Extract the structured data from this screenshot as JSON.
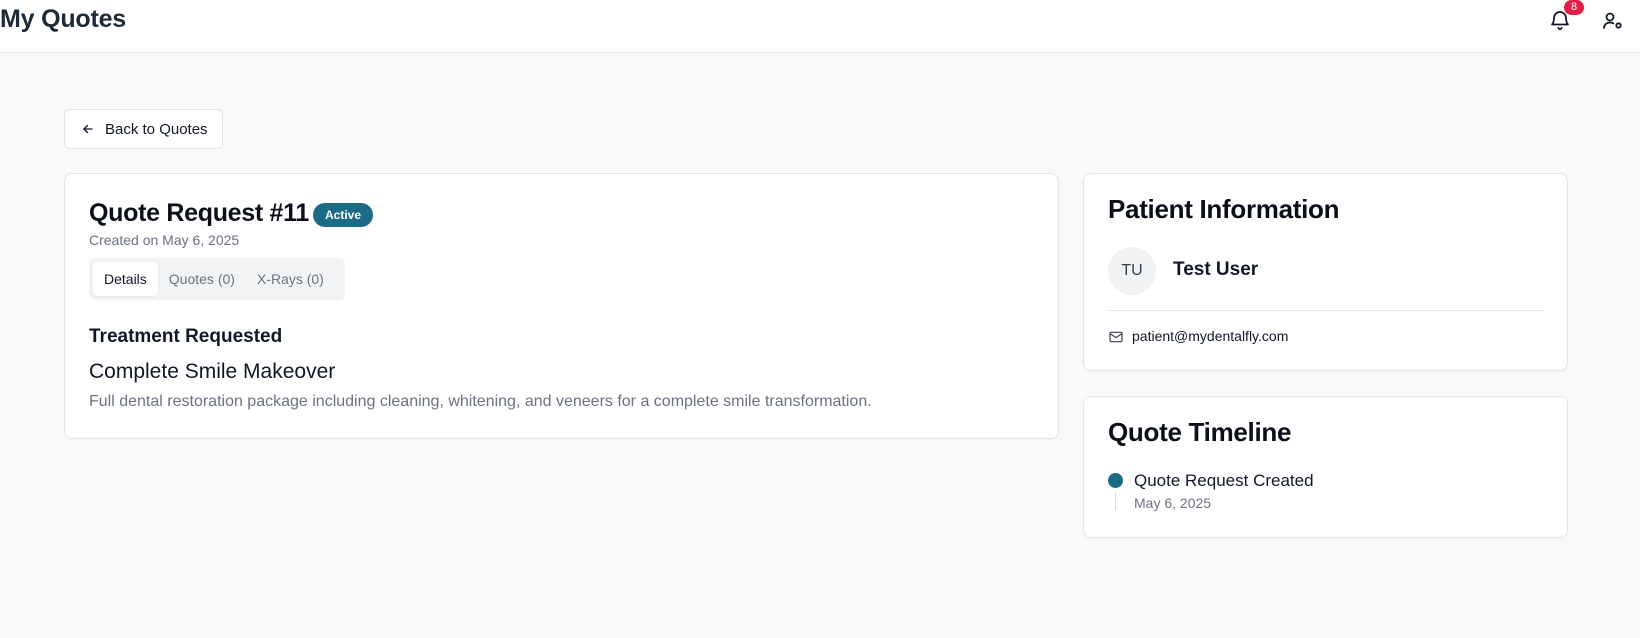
{
  "header": {
    "title": "My Quotes",
    "notification_count": "8",
    "icons": [
      "bell-icon",
      "user-settings-icon"
    ]
  },
  "back_button": {
    "label": "Back to Quotes",
    "icon": "arrow-left-icon"
  },
  "quote": {
    "title": "Quote Request #11",
    "status": "Active",
    "created": "Created on May 6, 2025",
    "tabs": [
      {
        "label": "Details",
        "active": true
      },
      {
        "label": "Quotes (0)",
        "active": false
      },
      {
        "label": "X-Rays (0)",
        "active": false
      }
    ],
    "section_heading": "Treatment Requested",
    "treatment_name": "Complete Smile Makeover",
    "treatment_description": "Full dental restoration package including cleaning, whitening, and veneers for a complete smile transformation."
  },
  "patient": {
    "card_title": "Patient Information",
    "initials": "TU",
    "name": "Test User",
    "email": "patient@mydentalfly.com",
    "email_icon": "mail-icon"
  },
  "timeline": {
    "card_title": "Quote Timeline",
    "events": [
      {
        "label": "Quote Request Created",
        "date": "May 6, 2025"
      }
    ]
  },
  "colors": {
    "accent": "#1b6b85",
    "badge_red": "#e11d48",
    "background": "#f8f9fb",
    "muted_text": "#6b7280"
  }
}
